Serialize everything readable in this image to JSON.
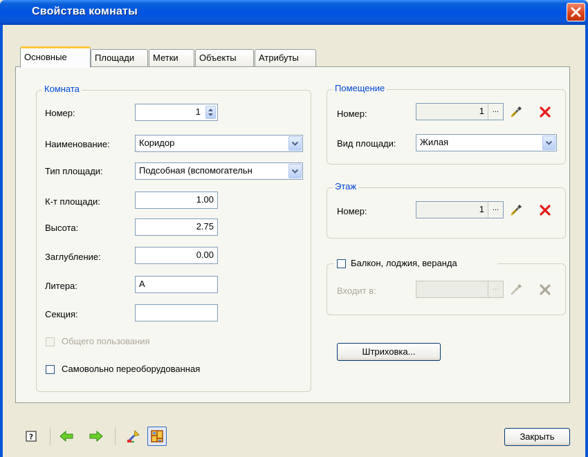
{
  "window": {
    "title": "Свойства комнаты"
  },
  "tabs": [
    "Основные",
    "Площади",
    "Метки",
    "Объекты",
    "Атрибуты"
  ],
  "room": {
    "group_title": "Комната",
    "number_label": "Номер:",
    "number_value": "1",
    "name_label": "Наименование:",
    "name_value": "Коридор",
    "area_type_label": "Тип площади:",
    "area_type_value": "Подсобная (вспомогательн",
    "coef_label": "К-т площади:",
    "coef_value": "1.00",
    "height_label": "Высота:",
    "height_value": "2.75",
    "depth_label": "Заглубление:",
    "depth_value": "0.00",
    "letter_label": "Литера:",
    "letter_value": "А",
    "section_label": "Секция:",
    "section_value": "",
    "common_use_label": "Общего пользования",
    "self_reequipped_label": "Самовольно переоборудованная"
  },
  "premises": {
    "group_title": "Помещение",
    "number_label": "Номер:",
    "number_value": "1",
    "area_kind_label": "Вид площади:",
    "area_kind_value": "Жилая"
  },
  "floor": {
    "group_title": "Этаж",
    "number_label": "Номер:",
    "number_value": "1"
  },
  "balcony": {
    "checkbox_label": "Балкон, лоджия, веранда",
    "included_in_label": "Входит в:",
    "included_in_value": ""
  },
  "hatch_button": "Штриховка...",
  "ellipsis": "...",
  "close_button": "Закрыть",
  "colors": {
    "accent": "#0046d5",
    "titlebar": "#0054e3",
    "close_red": "#d9401a",
    "delete_red": "#e51a1a"
  }
}
